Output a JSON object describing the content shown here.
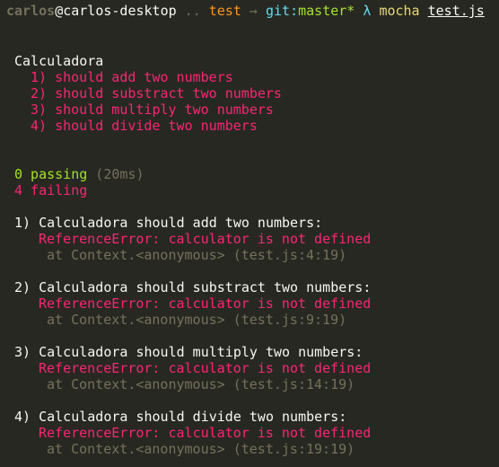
{
  "prompt": {
    "user": "carlos",
    "host": "@carlos-desktop",
    "dots": " .. ",
    "dir": "test",
    "arrow": " → ",
    "git_label": "git:",
    "branch": "master*",
    "lambda": " λ ",
    "command": "mocha ",
    "argument": "test.js"
  },
  "suite": {
    "title": "Calculadora",
    "tests": [
      "1) should add two numbers",
      "2) should substract two numbers",
      "3) should multiply two numbers",
      "4) should divide two numbers"
    ]
  },
  "summary": {
    "passing": "0 passing",
    "duration": " (20ms)",
    "failing": "4 failing"
  },
  "failures": [
    {
      "title": "1) Calculadora should add two numbers:",
      "error": "ReferenceError: calculator is not defined",
      "location": "at Context.<anonymous> (test.js:4:19)"
    },
    {
      "title": "2) Calculadora should substract two numbers:",
      "error": "ReferenceError: calculator is not defined",
      "location": "at Context.<anonymous> (test.js:9:19)"
    },
    {
      "title": "3) Calculadora should multiply two numbers:",
      "error": "ReferenceError: calculator is not defined",
      "location": "at Context.<anonymous> (test.js:14:19)"
    },
    {
      "title": "4) Calculadora should divide two numbers:",
      "error": "ReferenceError: calculator is not defined",
      "location": "at Context.<anonymous> (test.js:19:19)"
    }
  ]
}
